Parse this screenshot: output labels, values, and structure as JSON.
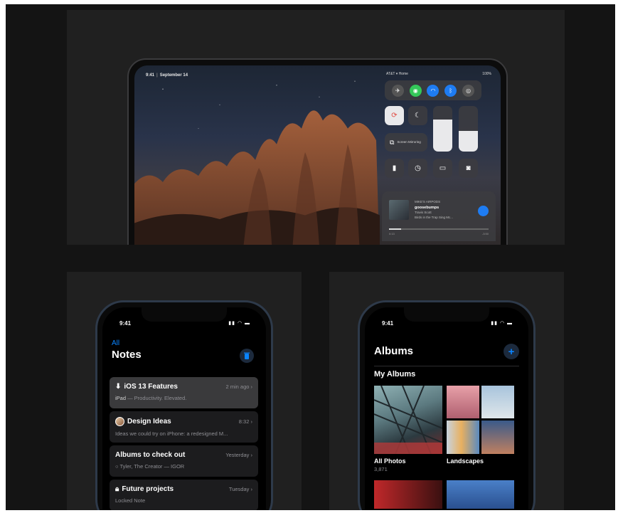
{
  "ipad": {
    "status_time": "9:41",
    "status_date": "September 14",
    "control_center": {
      "carrier": "AT&T",
      "network": "Home",
      "battery": "100%",
      "screen_mirroring_label": "Screen Mirroring",
      "music": {
        "source": "MIKE'S AIRPODS",
        "track": "goosebumps",
        "artist": "Travis Scott",
        "album": "Birds in the Trap Sing Mc...",
        "elapsed": "0:13",
        "remaining": "-3:50",
        "progress": 0.12
      }
    }
  },
  "notes_phone": {
    "time": "9:41",
    "back_label": "All",
    "title": "Notes",
    "notes": [
      {
        "title": "iOS 13 Features",
        "date": "2 min ago",
        "sub_strong": "iPad",
        "sub": " — Productivity. Elevated."
      },
      {
        "title": "Design Ideas",
        "date": "8:32",
        "sub_strong": "",
        "sub": "Ideas we could try on iPhone: a redesigned M..."
      },
      {
        "title": "Albums to check out",
        "date": "Yesterday",
        "sub_strong": "",
        "sub": "Tyler, The Creator — IGOR"
      },
      {
        "title": "Future projects",
        "date": "Tuesday",
        "sub_strong": "",
        "sub": "Locked Note"
      }
    ]
  },
  "albums_phone": {
    "time": "9:41",
    "title": "Albums",
    "section": "My Albums",
    "albums": [
      {
        "name": "All Photos",
        "count": "3,871"
      },
      {
        "name": "Landscapes",
        "count": ""
      }
    ]
  },
  "colors": {
    "accent_blue": "#0a84ff",
    "wifi_green": "#34c759",
    "background": "#141414"
  }
}
